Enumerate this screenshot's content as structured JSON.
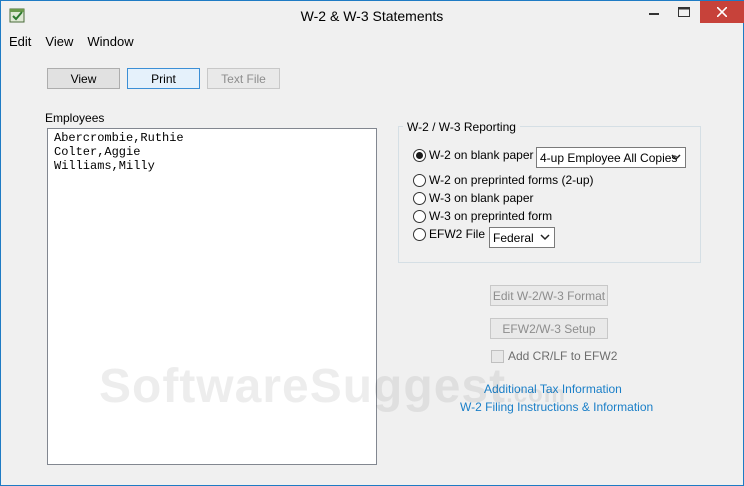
{
  "window": {
    "title": "W-2 & W-3 Statements",
    "accent_color": "#1e7bc4",
    "close_color": "#c7423a"
  },
  "menu": {
    "items": [
      "Edit",
      "View",
      "Window"
    ]
  },
  "toolbar": {
    "view_label": "View",
    "print_label": "Print",
    "text_file_label": "Text File"
  },
  "employees": {
    "label": "Employees",
    "items": [
      "Abercrombie,Ruthie",
      "Colter,Aggie",
      "Williams,Milly"
    ]
  },
  "reporting": {
    "title": "W-2 / W-3 Reporting",
    "options": [
      {
        "label": "W-2 on blank paper",
        "selected": true
      },
      {
        "label": "W-2 on preprinted forms (2-up)",
        "selected": false
      },
      {
        "label": "W-3 on blank paper",
        "selected": false
      },
      {
        "label": "W-3 on preprinted form",
        "selected": false
      },
      {
        "label": "EFW2 File",
        "selected": false
      }
    ],
    "copies_select": "4-up Employee All Copies",
    "efw2_select": "Federal"
  },
  "actions": {
    "edit_format_label": "Edit W-2/W-3 Format",
    "efw2_setup_label": "EFW2/W-3 Setup",
    "crlf_label": "Add CR/LF to EFW2"
  },
  "links": {
    "additional_tax": "Additional Tax Information",
    "filing_instructions": "W-2 Filing Instructions & Information",
    "link_color": "#1a7fc8"
  },
  "watermark": {
    "text": "SoftwareSuggest",
    "suffix": ".com"
  }
}
